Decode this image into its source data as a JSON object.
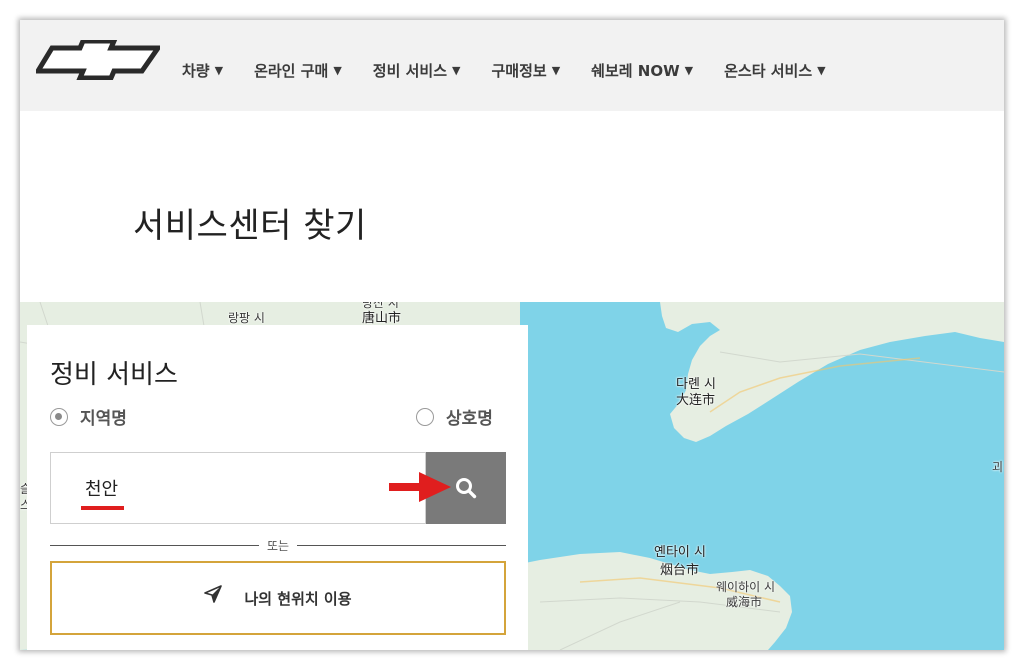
{
  "nav": {
    "items": [
      {
        "label": "차량",
        "caret": "▼"
      },
      {
        "label": "온라인 구매",
        "caret": "▼"
      },
      {
        "label": "정비 서비스",
        "caret": "▼"
      },
      {
        "label": "구매정보",
        "caret": "▼"
      },
      {
        "label": "쉐보레 NOW",
        "caret": "▼"
      },
      {
        "label": "온스타 서비스",
        "caret": "▼"
      }
    ]
  },
  "page": {
    "title": "서비스센터 찾기"
  },
  "panel": {
    "title": "정비 서비스",
    "radio_region": "지역명",
    "radio_business": "상호명",
    "search_value": "천안",
    "divider_text": "또는",
    "locate_label": "나의 현위치 이용"
  },
  "map": {
    "labels": {
      "tangshan_top": "탕산 시",
      "langfang": "랑팡 시",
      "tangshan_cn": "唐山市",
      "dalian_kr": "다롄 시",
      "dalian_cn": "大连市",
      "yantai_kr": "옌타이 시",
      "yantai_cn": "烟台市",
      "weihai_kr": "웨이하이 시",
      "weihai_cn": "威海市",
      "edge_right": "괴",
      "edge_left_1": "슬",
      "edge_left_2": "스"
    }
  },
  "colors": {
    "nav_bg": "#f2f2f2",
    "sea": "#7fd3e8",
    "land": "#e6eee2",
    "search_button": "#7a7a7a",
    "accent_red": "#e01e1e",
    "locate_border": "#d4a43b"
  }
}
